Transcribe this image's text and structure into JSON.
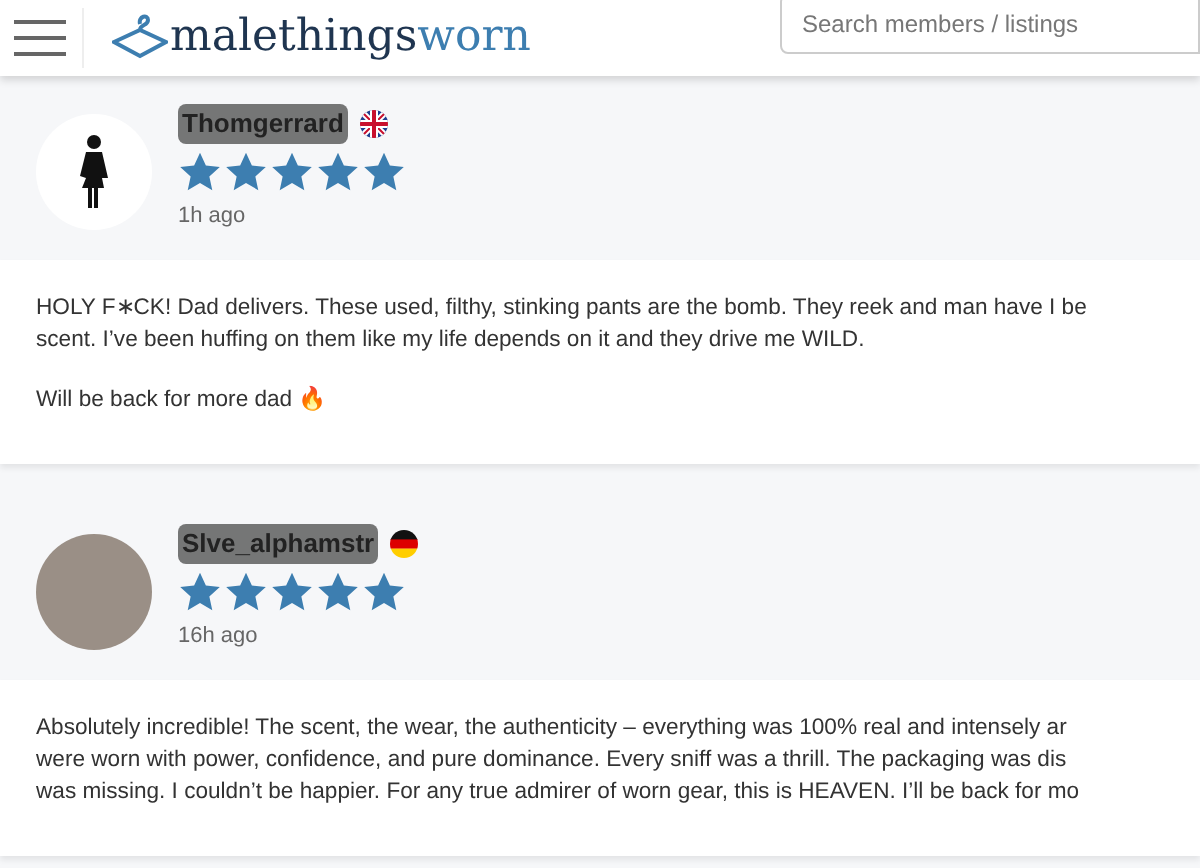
{
  "header": {
    "logo": {
      "brand": "malethings",
      "accent": "worn"
    },
    "search": {
      "placeholder": "Search members / listings"
    }
  },
  "reviews": [
    {
      "username": "Thomgerrard",
      "flag": {
        "kind": "uk"
      },
      "avatar": {
        "kind": "silhouette"
      },
      "stars": 5,
      "time": "1h ago",
      "paragraphs": [
        [
          "HOLY F∗CK! Dad delivers. These used, filthy, stinking pants are the bomb. They reek and man have I be",
          "scent. I’ve been huffing on them like my life depends on it and they drive me WILD."
        ],
        [
          "Will be back for more dad 🔥"
        ]
      ]
    },
    {
      "username": "Slve_alphamstr",
      "flag": {
        "kind": "de"
      },
      "avatar": {
        "kind": "photo"
      },
      "stars": 5,
      "time": "16h ago",
      "paragraphs": [
        [
          "Absolutely incredible! The scent, the wear, the authenticity – everything was 100% real and intensely ar",
          "were worn with power, confidence, and pure dominance. Every sniff was a thrill. The packaging was dis",
          "was missing. I couldn’t be happier. For any true admirer of worn gear, this is HEAVEN. I’ll be back for mo"
        ]
      ]
    }
  ]
}
